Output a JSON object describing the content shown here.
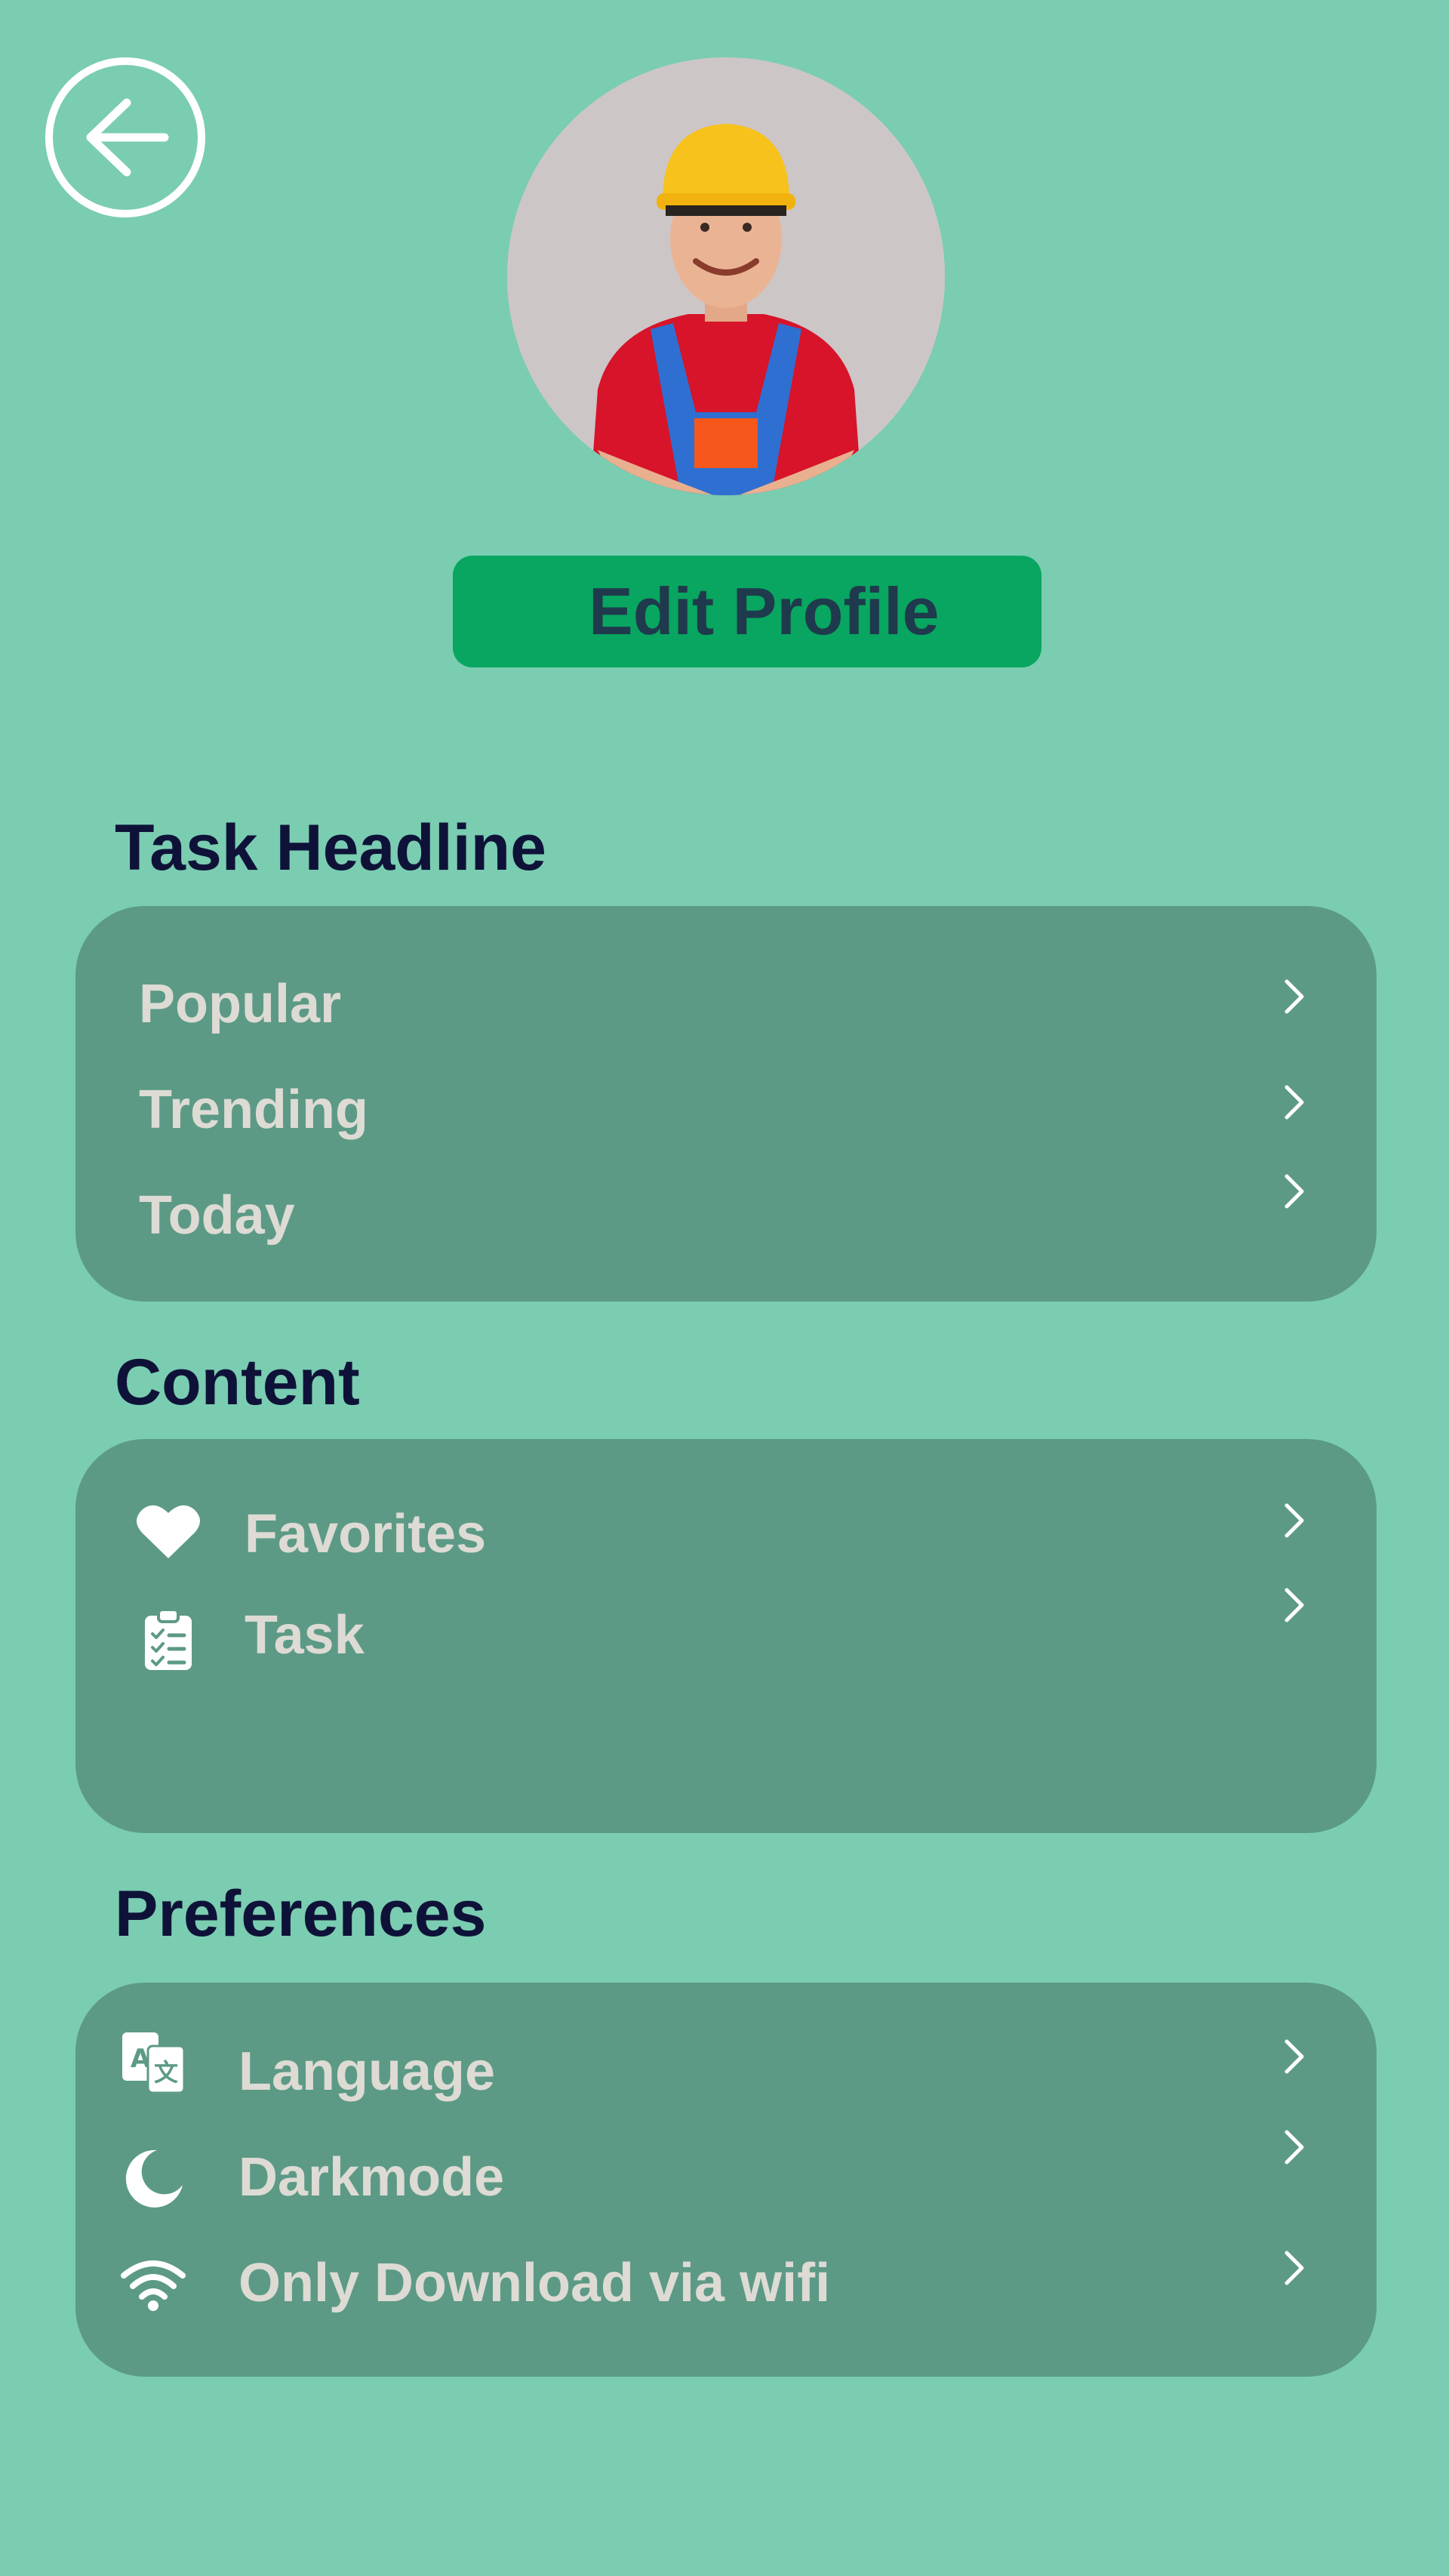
{
  "header": {
    "back_icon": "arrow-left-icon",
    "edit_profile_label": "Edit Profile"
  },
  "sections": {
    "task_headline": {
      "title": "Task Headline",
      "items": [
        {
          "label": "Popular"
        },
        {
          "label": "Trending"
        },
        {
          "label": "Today"
        }
      ]
    },
    "content": {
      "title": "Content",
      "items": [
        {
          "label": "Favorites",
          "icon": "heart-icon"
        },
        {
          "label": "Task",
          "icon": "clipboard-checklist-icon"
        }
      ]
    },
    "preferences": {
      "title": "Preferences",
      "items": [
        {
          "label": "Language",
          "icon": "translate-icon"
        },
        {
          "label": "Darkmode",
          "icon": "moon-icon"
        },
        {
          "label": "Only Download via wifi",
          "icon": "wifi-icon"
        }
      ]
    }
  },
  "colors": {
    "background": "#7acdb1",
    "card": "#5c9a86",
    "accent_button": "#08a660",
    "title_text": "#0f1238",
    "row_text": "#dddbd4"
  }
}
